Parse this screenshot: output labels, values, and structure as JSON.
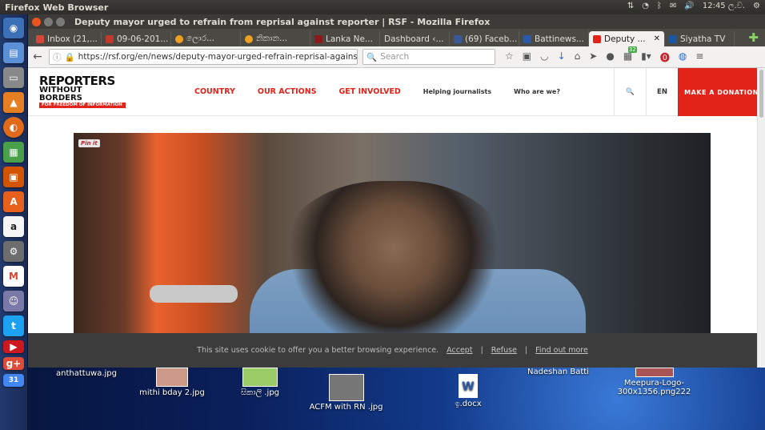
{
  "os": {
    "app_title": "Firefox Web Browser",
    "time": "12:45 ල.ව."
  },
  "window": {
    "title": "Deputy mayor urged to refrain from reprisal against reporter | RSF - Mozilla Firefox"
  },
  "tabs": [
    {
      "label": "Inbox (21,...",
      "color": "#d44638"
    },
    {
      "label": "09-06-201...",
      "color": "#c0392b"
    },
    {
      "label": "ලොර...",
      "color": "#f0a020"
    },
    {
      "label": "නිකාන...",
      "color": "#f0a020"
    },
    {
      "label": "Lanka Ne...",
      "color": "#8b1a1a"
    },
    {
      "label": "Dashboard ‹...",
      "color": "#777777"
    },
    {
      "label": "(69) Faceb...",
      "color": "#3b5998"
    },
    {
      "label": "Battinews...",
      "color": "#2a5aa8"
    },
    {
      "label": "Deputy ...",
      "color": "#e2231a"
    },
    {
      "label": "Siyatha TV",
      "color": "#1c57a5"
    }
  ],
  "nav": {
    "url": "https://rsf.org/en/news/deputy-mayor-urged-refrain-reprisal-against-r",
    "search_placeholder": "Search",
    "badge": "32"
  },
  "site": {
    "logo_line1": "REPORTERS",
    "logo_line2": "WITHOUT BORDERS",
    "logo_line3": "FOR FREEDOM OF INFORMATION",
    "menu": [
      "COUNTRY",
      "OUR ACTIONS",
      "GET INVOLVED"
    ],
    "menu_secondary": [
      "Helping journalists",
      "Who are we?"
    ],
    "lang": "EN",
    "donate": "MAKE A DONATION",
    "pinit": "Pin it"
  },
  "cookie": {
    "text": "This site uses cookie to offer you a better browsing experience.",
    "accept": "Accept",
    "refuse": "Refuse",
    "find_out": "Find out more",
    "sep": "|"
  },
  "desktop": {
    "files": [
      "anthattuwa.jpg",
      "mithi bday 2.jpg",
      "සිකාලි .jpg",
      "ACFM with RN .jpg",
      "ඉ.docx",
      "Nadeshan Batti",
      "Meepura-Logo-300x1356.png222"
    ]
  }
}
